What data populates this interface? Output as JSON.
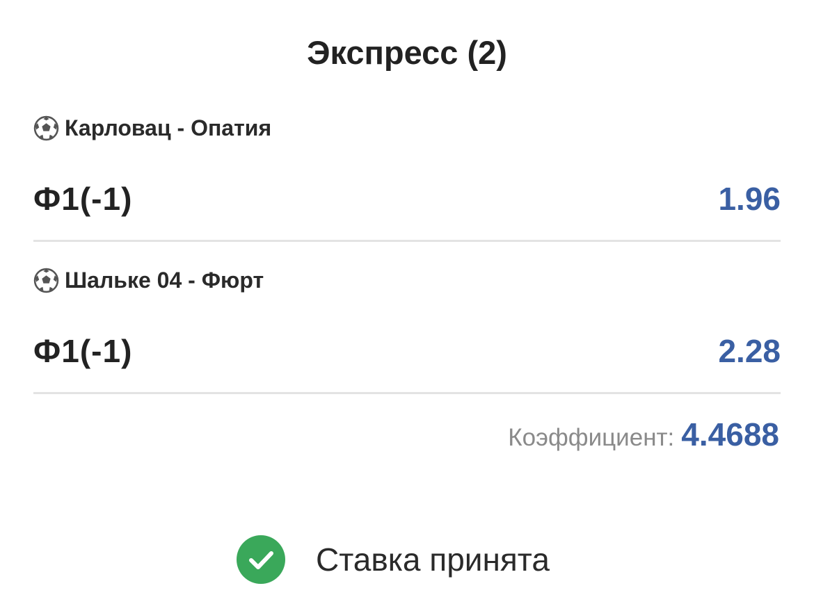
{
  "title": "Экспресс (2)",
  "events": [
    {
      "icon": "soccer-ball-icon",
      "name": "Карловац - Опатия",
      "pick": "Ф1(-1)",
      "odds": "1.96"
    },
    {
      "icon": "soccer-ball-icon",
      "name": "Шальке 04 - Фюрт",
      "pick": "Ф1(-1)",
      "odds": "2.28"
    }
  ],
  "total": {
    "label": "Коэффициент:",
    "value": "4.4688"
  },
  "status": {
    "icon": "check-circle-icon",
    "text": "Ставка принята",
    "color": "#3aa85a"
  },
  "colors": {
    "accent": "#3a5fa3",
    "divider": "#e3e3e3",
    "muted": "#8a8a8a"
  }
}
